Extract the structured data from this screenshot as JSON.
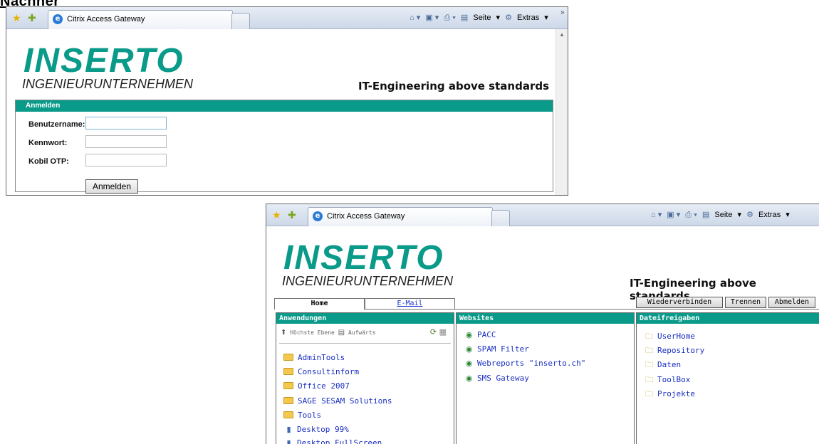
{
  "page_label": "Nachher",
  "colors": {
    "brand_teal": "#0a9a8a",
    "link_blue": "#1a2fc0"
  },
  "browser": {
    "tab_title": "Citrix Access Gateway",
    "commands": {
      "page": "Seite",
      "extras": "Extras"
    },
    "icons": [
      "favorites-star-icon",
      "add-favorites-icon",
      "ie-page-icon",
      "home-icon",
      "feeds-icon",
      "print-icon",
      "page-icon",
      "tools-gear-icon"
    ]
  },
  "brand": {
    "logo": "INSERTO",
    "subtitle": "INGENIEURUNTERNEHMEN",
    "tagline": "IT-Engineering above standards"
  },
  "login": {
    "header": "Anmelden",
    "fields": [
      {
        "label": "Benutzername:",
        "value": ""
      },
      {
        "label": "Kennwort:",
        "value": ""
      },
      {
        "label": "Kobil OTP:",
        "value": ""
      }
    ],
    "submit": "Anmelden"
  },
  "portal": {
    "tabs": {
      "home": "Home",
      "email": "E-Mail"
    },
    "actions": {
      "reconnect": "Wiederverbinden",
      "disconnect": "Trennen",
      "logout": "Abmelden"
    },
    "applications": {
      "header": "Anwendungen",
      "nav": {
        "top": "Höchste Ebene",
        "up": "Aufwärts"
      },
      "items": [
        {
          "label": "AdminTools",
          "type": "folder"
        },
        {
          "label": "Consultinform",
          "type": "folder"
        },
        {
          "label": "Office 2007",
          "type": "folder"
        },
        {
          "label": "SAGE SESAM Solutions",
          "type": "folder"
        },
        {
          "label": "Tools",
          "type": "folder"
        },
        {
          "label": "Desktop 99%",
          "type": "desktop"
        },
        {
          "label": "Desktop FullScreen",
          "type": "desktop"
        }
      ]
    },
    "websites": {
      "header": "Websites",
      "items": [
        "PACC",
        "SPAM Filter",
        "Webreports \"inserto.ch\"",
        "SMS Gateway"
      ]
    },
    "shares": {
      "header": "Dateifreigaben",
      "items": [
        "UserHome",
        "Repository",
        "Daten",
        "ToolBox",
        "Projekte"
      ]
    }
  }
}
